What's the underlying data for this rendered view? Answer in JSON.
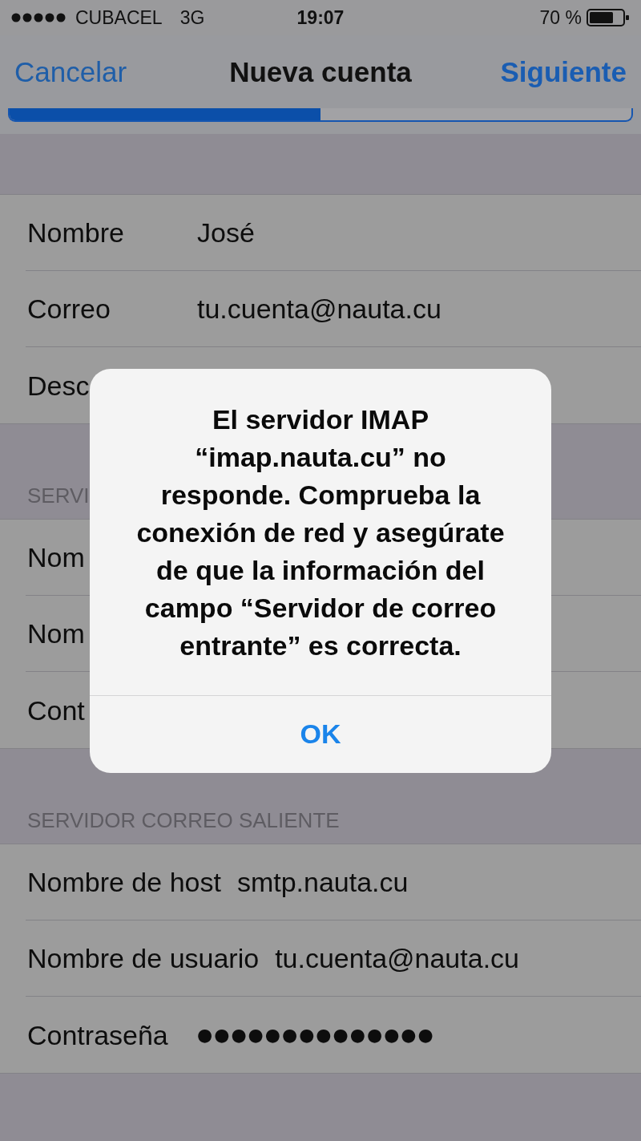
{
  "status_bar": {
    "carrier": "CUBACEL",
    "network": "3G",
    "time": "19:07",
    "battery": "70 %"
  },
  "nav_bar": {
    "left_button": "Cancelar",
    "title": "Nueva cuenta",
    "right_button": "Siguiente"
  },
  "progress": {
    "level": 0.5
  },
  "sections": [
    {
      "rows": [
        {
          "kind": "text",
          "label": "Nombre",
          "value": "José"
        },
        {
          "kind": "text",
          "label": "Correo",
          "value": "tu.cuenta@nauta.cu"
        },
        {
          "kind": "text",
          "label": "Desc"
        }
      ]
    },
    {
      "header": "SERVI",
      "rows": [
        {
          "kind": "text",
          "label": "Nom"
        },
        {
          "kind": "text",
          "label": "Nom"
        },
        {
          "kind": "text",
          "label": "Cont"
        }
      ]
    },
    {
      "header": "SERVIDOR CORREO SALIENTE",
      "rows": [
        {
          "kind": "text",
          "label": "Nombre de host",
          "value": "smtp.nauta.cu"
        },
        {
          "kind": "text",
          "label": "Nombre de usuario",
          "value": "tu.cuenta@nauta.cu"
        },
        {
          "kind": "password",
          "label": "Contraseña",
          "value": "●●●●●●●●●●●●●●"
        }
      ]
    }
  ],
  "alert": {
    "message": "El servidor IMAP “imap.nauta.cu” no responde. Comprueba la conexión de red y asegúrate de que la información del campo “Servidor de correo entrante” es correcta.",
    "buttons": [
      "OK"
    ]
  }
}
